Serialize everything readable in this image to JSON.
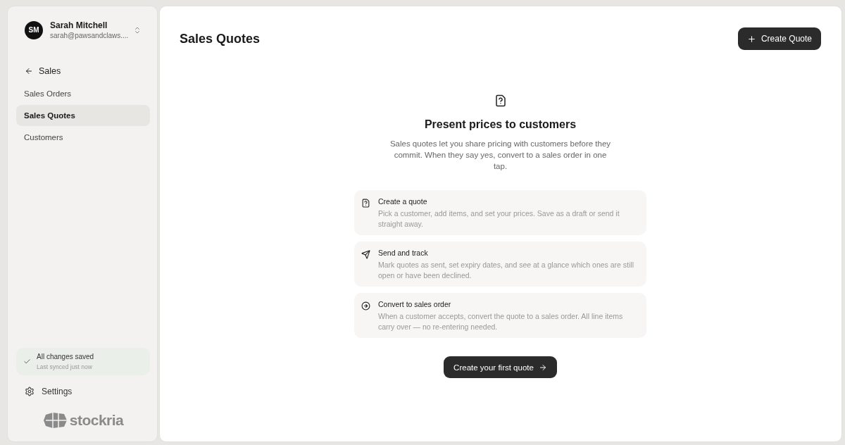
{
  "user": {
    "initials": "SM",
    "name": "Sarah Mitchell",
    "email": "sarah@pawsandclaws...."
  },
  "sidebar": {
    "back_label": "Sales",
    "items": [
      {
        "label": "Sales Orders",
        "selected": false
      },
      {
        "label": "Sales Quotes",
        "selected": true
      },
      {
        "label": "Customers",
        "selected": false
      }
    ],
    "sync": {
      "title": "All changes saved",
      "subtitle": "Last synced just now"
    },
    "settings_label": "Settings",
    "logo": "stockria"
  },
  "page": {
    "title": "Sales Quotes",
    "create_button": "Create Quote"
  },
  "empty_state": {
    "title": "Present prices to customers",
    "description": "Sales quotes let you share pricing with customers before they commit. When they say yes, convert to a sales order in one tap.",
    "features": [
      {
        "kind": "quote",
        "title": "Create a quote",
        "description": "Pick a customer, add items, and set your prices. Save as a draft or send it straight away."
      },
      {
        "kind": "send",
        "title": "Send and track",
        "description": "Mark quotes as sent, set expiry dates, and see at a glance which ones are still open or have been declined."
      },
      {
        "kind": "convert",
        "title": "Convert to sales order",
        "description": "When a customer accepts, convert the quote to a sales order. All line items carry over — no re-entering needed."
      }
    ],
    "cta": "Create your first quote"
  }
}
